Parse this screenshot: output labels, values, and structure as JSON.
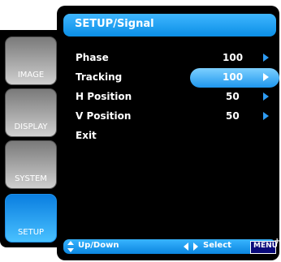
{
  "header": {
    "title": "SETUP/Signal"
  },
  "sidebar": {
    "tabs": [
      {
        "label": "IMAGE",
        "active": false
      },
      {
        "label": "DISPLAY",
        "active": false
      },
      {
        "label": "SYSTEM",
        "active": false
      },
      {
        "label": "SETUP",
        "active": true
      }
    ]
  },
  "menu": {
    "items": [
      {
        "label": "Phase",
        "value": "100",
        "selected": false
      },
      {
        "label": "Tracking",
        "value": "100",
        "selected": true
      },
      {
        "label": "H Position",
        "value": "50",
        "selected": false
      },
      {
        "label": "V Position",
        "value": "50",
        "selected": false
      },
      {
        "label": "Exit",
        "value": "",
        "selected": false
      }
    ]
  },
  "footer": {
    "updown_label": "Up/Down",
    "select_label": "Select",
    "menu_label": "MENU"
  },
  "colors": {
    "accent": "#1f97ee",
    "background": "#000000",
    "highlight": "#7ed0ff"
  }
}
